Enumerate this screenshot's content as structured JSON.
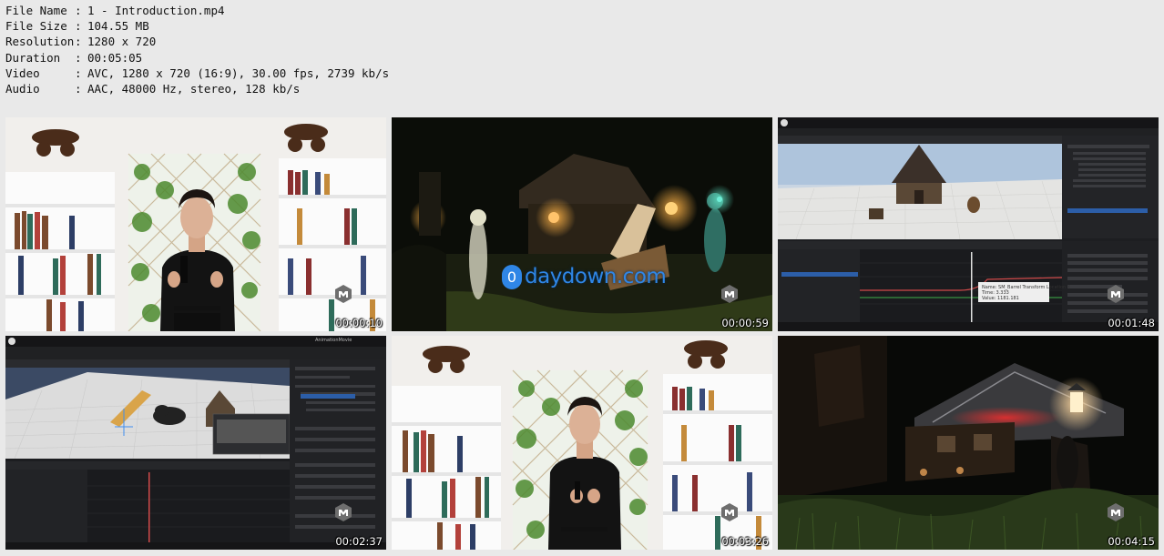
{
  "file_info": {
    "rows": [
      {
        "key": "File Name",
        "value": "1 - Introduction.mp4"
      },
      {
        "key": "File Size",
        "value": "104.55 MB"
      },
      {
        "key": "Resolution",
        "value": "1280 x 720"
      },
      {
        "key": "Duration",
        "value": "00:05:05"
      },
      {
        "key": "Video",
        "value": "AVC, 1280 x 720 (16:9), 30.00 fps, 2739 kb/s"
      },
      {
        "key": "Audio",
        "value": "AAC, 48000 Hz, stereo, 128 kb/s"
      }
    ],
    "separator": ":"
  },
  "thumbnails": [
    {
      "timestamp": "00:00:10",
      "scene": "presenter-shelves"
    },
    {
      "timestamp": "00:00:59",
      "scene": "dark-fantasy-village",
      "watermark": "daydown.com",
      "watermark_badge": "0"
    },
    {
      "timestamp": "00:01:48",
      "scene": "unreal-editor-sequencer",
      "tooltip": [
        "Name: SM_Barrel Transform Location X",
        "Time: 3.333",
        "Value: 1181.181"
      ]
    },
    {
      "timestamp": "00:02:37",
      "scene": "unreal-editor-camera",
      "menu": "AnimationMovie"
    },
    {
      "timestamp": "00:03:26",
      "scene": "presenter-shelves"
    },
    {
      "timestamp": "00:04:15",
      "scene": "night-village-lantern"
    }
  ],
  "colors": {
    "background": "#e9e9e9",
    "text": "#111111",
    "watermark": "#2f86e6"
  }
}
